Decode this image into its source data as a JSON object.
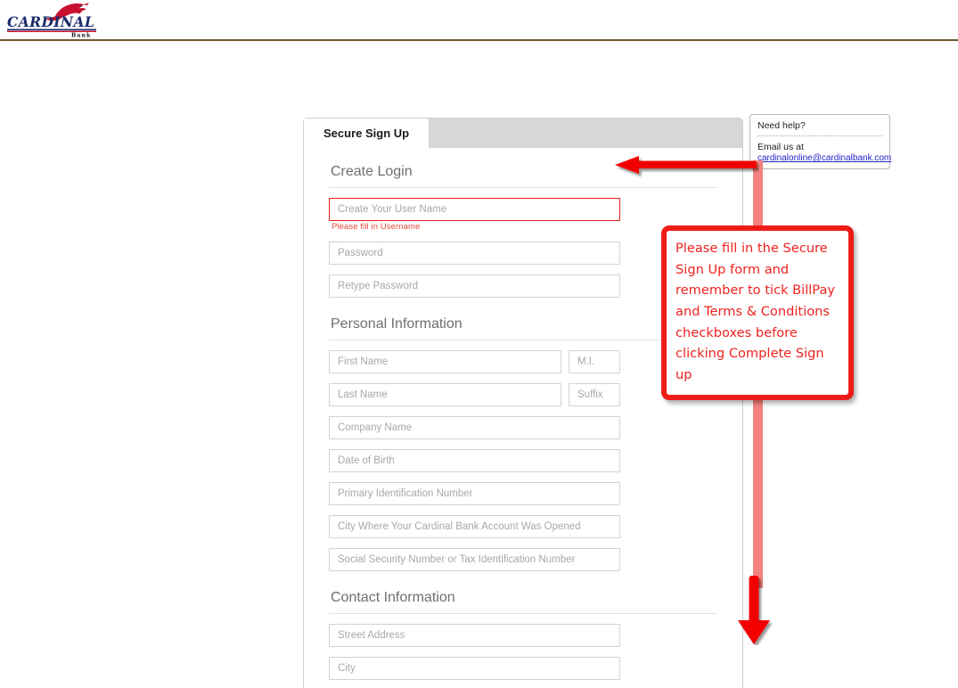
{
  "header": {
    "logo_name": "cardinal-bank-logo",
    "logo_wordmark": "CARDINAL",
    "logo_subtext": "Bank",
    "logo_color_blue": "#1b2a6b",
    "logo_color_red": "#c8102e",
    "rule_color": "#6b5b2a"
  },
  "panel": {
    "tabs": [
      {
        "label": "Secure Sign Up",
        "active": true
      }
    ]
  },
  "form": {
    "sections": [
      {
        "heading": "Create Login",
        "rows": [
          {
            "fields": [
              {
                "name": "username-input",
                "placeholder": "Create Your User Name",
                "size": "full",
                "error": true
              }
            ],
            "error_message": "Please fill in Username"
          },
          {
            "fields": [
              {
                "name": "password-input",
                "placeholder": "Password",
                "size": "full"
              }
            ]
          },
          {
            "fields": [
              {
                "name": "retype-password-input",
                "placeholder": "Retype Password",
                "size": "full"
              }
            ]
          }
        ]
      },
      {
        "heading": "Personal Information",
        "rows": [
          {
            "fields": [
              {
                "name": "first-name-input",
                "placeholder": "First Name",
                "size": "wide"
              },
              {
                "name": "middle-initial-input",
                "placeholder": "M.I.",
                "size": "small"
              }
            ]
          },
          {
            "fields": [
              {
                "name": "last-name-input",
                "placeholder": "Last Name",
                "size": "wide"
              },
              {
                "name": "suffix-input",
                "placeholder": "Suffix",
                "size": "small"
              }
            ]
          },
          {
            "fields": [
              {
                "name": "company-name-input",
                "placeholder": "Company Name",
                "size": "full"
              }
            ]
          },
          {
            "fields": [
              {
                "name": "date-of-birth-input",
                "placeholder": "Date of Birth",
                "size": "full"
              }
            ]
          },
          {
            "fields": [
              {
                "name": "primary-id-number-input",
                "placeholder": "Primary Identification Number",
                "size": "full"
              }
            ]
          },
          {
            "fields": [
              {
                "name": "account-city-input",
                "placeholder": "City Where Your Cardinal Bank Account Was Opened",
                "size": "full"
              }
            ]
          },
          {
            "fields": [
              {
                "name": "ssn-tin-input",
                "placeholder": "Social Security Number or Tax Identification Number",
                "size": "full"
              }
            ]
          }
        ]
      },
      {
        "heading": "Contact Information",
        "rows": [
          {
            "fields": [
              {
                "name": "street-address-input",
                "placeholder": "Street Address",
                "size": "full"
              }
            ]
          },
          {
            "fields": [
              {
                "name": "city-input",
                "placeholder": "City",
                "size": "full"
              }
            ]
          }
        ]
      }
    ]
  },
  "need_help": {
    "title": "Need help?",
    "email_label": "Email us at",
    "email_address": "cardinalonline@cardinalbank.com",
    "link_color": "#2222cc"
  },
  "annotation": {
    "callout_text": "Please fill in the Secure Sign Up form and remember to tick BillPay and Terms & Conditions checkboxes before clicking Complete Sign up",
    "callout_border_color": "#ee1c19",
    "callout_text_color": "#ee2320",
    "arrow_color": "#f20000",
    "connector_color": "#f4827e"
  }
}
